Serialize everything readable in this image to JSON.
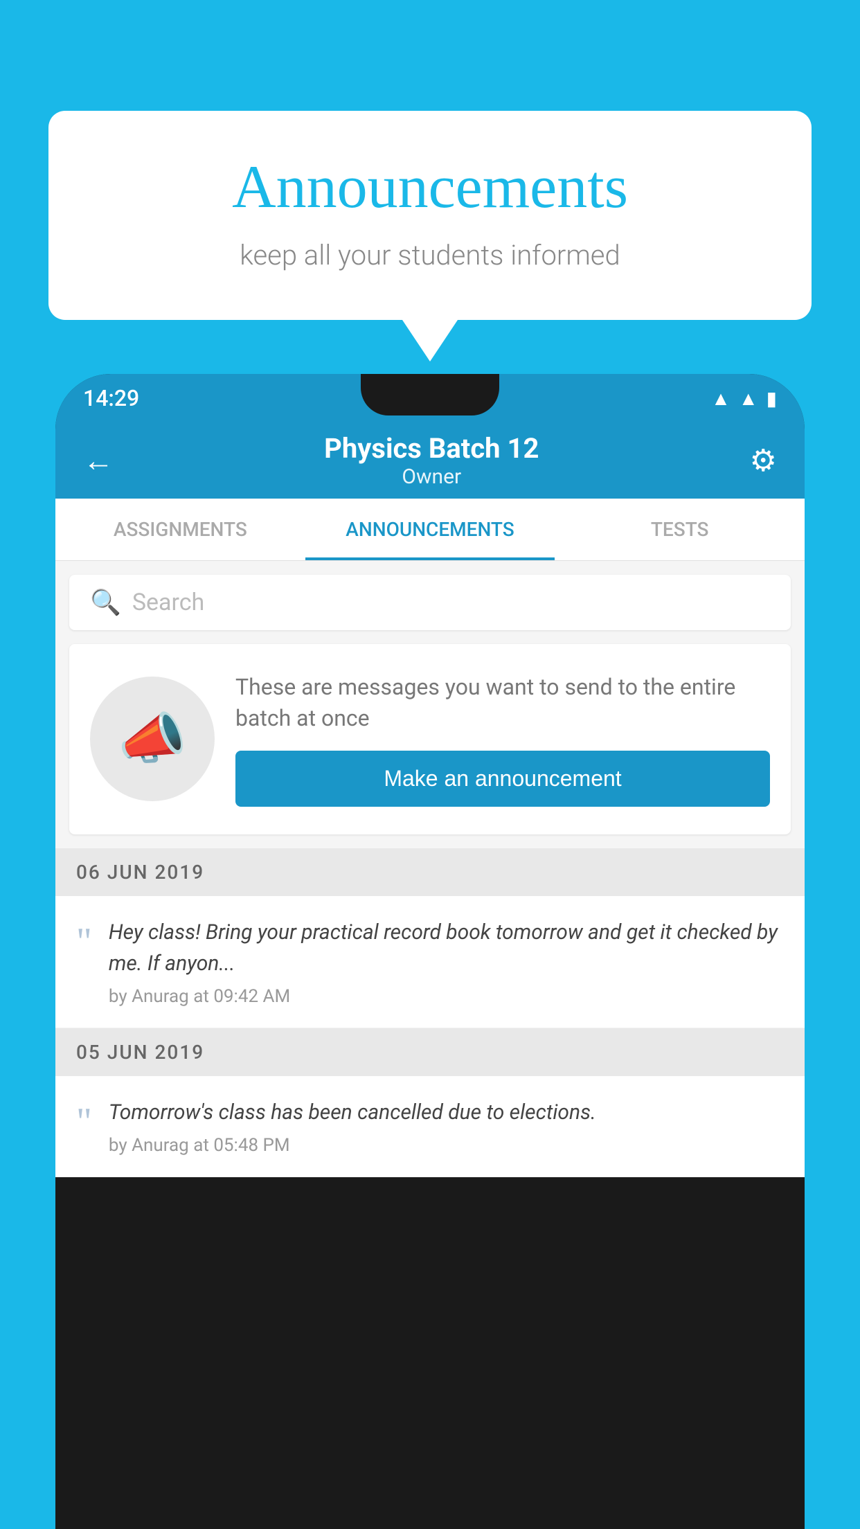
{
  "background": {
    "color": "#1ab8e8"
  },
  "speechBubble": {
    "title": "Announcements",
    "subtitle": "keep all your students informed"
  },
  "statusBar": {
    "time": "14:29",
    "icons": [
      "wifi",
      "signal",
      "battery"
    ]
  },
  "appBar": {
    "title": "Physics Batch 12",
    "subtitle": "Owner",
    "backLabel": "←",
    "settingsLabel": "⚙"
  },
  "tabs": [
    {
      "label": "ASSIGNMENTS",
      "active": false
    },
    {
      "label": "ANNOUNCEMENTS",
      "active": true
    },
    {
      "label": "TESTS",
      "active": false
    }
  ],
  "search": {
    "placeholder": "Search"
  },
  "announcementPrompt": {
    "description": "These are messages you want to send to the entire batch at once",
    "buttonLabel": "Make an announcement"
  },
  "dateSections": [
    {
      "date": "06  JUN  2019",
      "items": [
        {
          "text": "Hey class! Bring your practical record book tomorrow and get it checked by me. If anyon...",
          "meta": "by Anurag at 09:42 AM"
        }
      ]
    },
    {
      "date": "05  JUN  2019",
      "items": [
        {
          "text": "Tomorrow's class has been cancelled due to elections.",
          "meta": "by Anurag at 05:48 PM"
        }
      ]
    }
  ]
}
